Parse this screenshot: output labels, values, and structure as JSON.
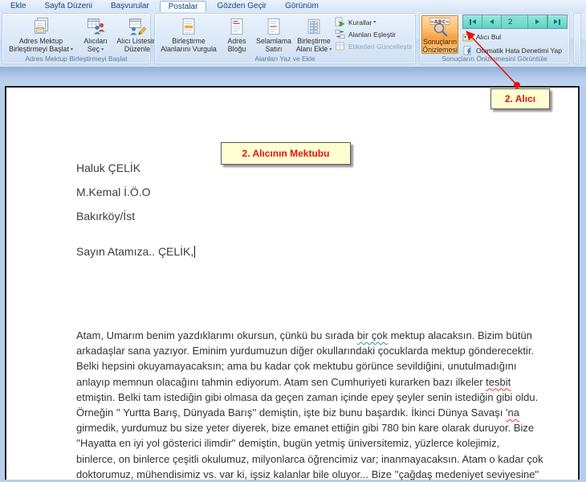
{
  "tabs": [
    {
      "label": "Ekle"
    },
    {
      "label": "Sayfa Düzeni"
    },
    {
      "label": "Başvurular"
    },
    {
      "label": "Postalar",
      "active": true
    },
    {
      "label": "Gözden Geçir"
    },
    {
      "label": "Görünüm"
    }
  ],
  "ribbon": {
    "groups": [
      {
        "label": "Adres Mektup Birleştirmeyi Başlat",
        "buttons": [
          {
            "lines": [
              "Adres Mektup",
              "Birleştirmeyi Başlat"
            ],
            "dropdown": "▾"
          },
          {
            "lines": [
              "Alıcıları",
              "Seç"
            ],
            "dropdown": "▾"
          },
          {
            "lines": [
              "Alıcı Listesini",
              "Düzenle"
            ]
          }
        ]
      },
      {
        "label": "Alanları Yaz ve Ekle",
        "buttons": [
          {
            "lines": [
              "Birleştirme",
              "Alanlarını Vurgula"
            ]
          },
          {
            "lines": [
              "Adres",
              "Bloğu"
            ]
          },
          {
            "lines": [
              "Selamlama",
              "Satırı"
            ]
          },
          {
            "lines": [
              "Birleştirme",
              "Alanı Ekle"
            ],
            "dropdown": "▾"
          }
        ],
        "small_buttons": [
          {
            "label": "Kurallar",
            "dropdown": "▾"
          },
          {
            "label": "Alanları Eşleştir"
          },
          {
            "label": "Etiketleri Güncelleştir",
            "disabled": true
          }
        ]
      },
      {
        "label": "Sonuçların Önizlemesini Görüntüle",
        "preview_toggle": {
          "lines": [
            "Sonuçların",
            "Önizlemesi"
          ],
          "pressed": true
        },
        "record_nav": {
          "current": "2",
          "highlight_color": "#5dd3c1"
        },
        "small_buttons": [
          {
            "label": "Alıcı Bul"
          },
          {
            "label": "Otomatik Hata Denetimi Yap"
          }
        ]
      }
    ]
  },
  "annotations": {
    "record_tag": "2. Alıcı",
    "letter_tag": "2. Alıcının Mektubu",
    "accent_red": "#e2130e",
    "callout_bg": "#ffffd2"
  },
  "letter": {
    "address_lines": [
      "Haluk ÇELİK",
      "M.Kemal İ.Ö.O",
      "Bakırköy/İst"
    ],
    "salutation": "Sayın Atamıza.. ÇELİK,",
    "body_lines": [
      [
        {
          "t": "Atam, Umarım benim yazdıklarımı okursun, çünkü bu sırada "
        },
        {
          "t": "bir çok",
          "m": "green"
        },
        {
          "t": " mektup alacaksın. Bizim bütün"
        }
      ],
      [
        {
          "t": "arkadaşlar sana yazıyor. Eminim yurdumuzun diğer okullarındaki çocuklarda mektup gönderecektir."
        }
      ],
      [
        {
          "t": "Belki hepsini okuyamayacaksın; ama bu kadar çok mektubu görünce sevildiğini, unutulmadığını"
        }
      ],
      [
        {
          "t": "anlayıp memnun olacağını tahmin ediyorum. Atam sen Cumhuriyeti kurarken bazı ilkeler "
        },
        {
          "t": "tesbit",
          "m": "red"
        }
      ],
      [
        {
          "t": "etmiştin. Belki tam istediğin gibi olmasa da geçen zaman içinde epey şeyler senin istediğin gibi oldu."
        }
      ],
      [
        {
          "t": "Örneğin '' Yurtta Barış, Dünyada Barış'' demiştin, işte biz bunu başardık. İkinci Dünya Savaşı "
        },
        {
          "t": "'na",
          "m": "red"
        }
      ],
      [
        {
          "t": "girmedik, yurdumuz bu size yeter diyerek, bize emanet ettiğin gibi 780 bin kare olarak duruyor. Bize"
        }
      ],
      [
        {
          "t": "''Hayatta en iyi yol gösterici ilimdir'' demiştin, bugün yetmiş üniversitemiz, yüzlerce kolejimiz,"
        }
      ],
      [
        {
          "t": "binlerce, on binlerce çeşitli okulumuz, milyonlarca öğrencimiz var; inanmayacaksın. Atam o kadar çok"
        }
      ],
      [
        {
          "t": "doktorumuz, mühendisimiz vs. var ki, işsiz kalanlar bile oluyor... Bize ''çağdaş medeniyet seviyesine''"
        }
      ]
    ]
  }
}
